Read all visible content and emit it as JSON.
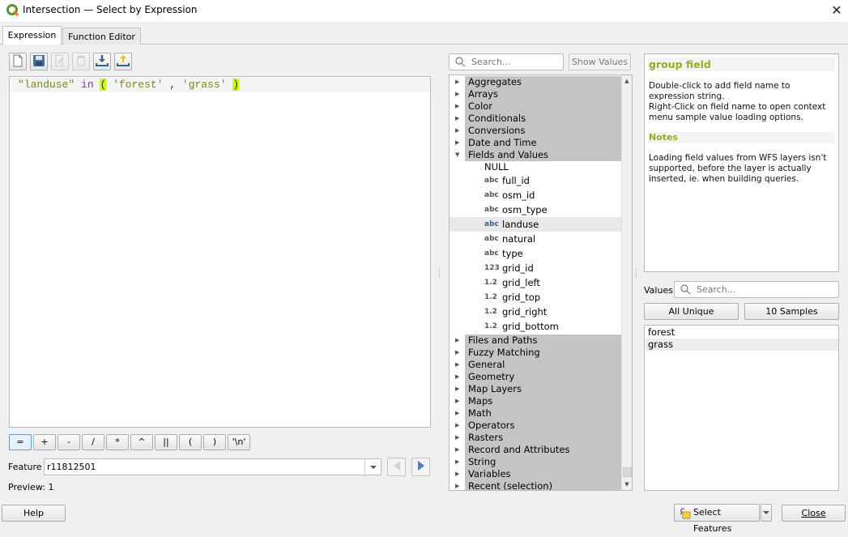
{
  "window": {
    "title": "Intersection — Select by Expression",
    "close_glyph": "✕"
  },
  "tabs": [
    {
      "label": "Expression",
      "active": true
    },
    {
      "label": "Function Editor",
      "active": false
    }
  ],
  "toolbar": {
    "buttons": [
      {
        "name": "new-file",
        "enabled": true
      },
      {
        "name": "save",
        "enabled": true
      },
      {
        "name": "edit",
        "enabled": false
      },
      {
        "name": "delete",
        "enabled": false
      },
      {
        "name": "import",
        "enabled": true
      },
      {
        "name": "export",
        "enabled": true
      }
    ]
  },
  "editor": {
    "tokens": [
      {
        "text": "\"landuse\"",
        "kind": "str"
      },
      {
        "text": " ",
        "kind": "plain"
      },
      {
        "text": "in",
        "kind": "kw"
      },
      {
        "text": " ",
        "kind": "plain"
      },
      {
        "text": "(",
        "kind": "paren"
      },
      {
        "text": " ",
        "kind": "plain"
      },
      {
        "text": "'forest'",
        "kind": "str"
      },
      {
        "text": " , ",
        "kind": "plain"
      },
      {
        "text": "'grass'",
        "kind": "str"
      },
      {
        "text": " ",
        "kind": "plain"
      },
      {
        "text": ")",
        "kind": "paren"
      }
    ]
  },
  "operators": [
    "=",
    "+",
    "-",
    "/",
    "*",
    "^",
    "||",
    "(",
    ")",
    "'\\n'"
  ],
  "feature": {
    "label": "Feature",
    "value": "r11812501"
  },
  "preview": {
    "label": "Preview:",
    "value": "1"
  },
  "function_panel": {
    "search_placeholder": "Search...",
    "show_values_label": "Show Values",
    "groups_before": [
      "Aggregates",
      "Arrays",
      "Color",
      "Conditionals",
      "Conversions",
      "Date and Time"
    ],
    "expanded_group": "Fields and Values",
    "null_item": "NULL",
    "fields": [
      {
        "type": "abc",
        "name": "full_id"
      },
      {
        "type": "abc",
        "name": "osm_id"
      },
      {
        "type": "abc",
        "name": "osm_type"
      },
      {
        "type": "abc",
        "name": "landuse",
        "highlighted": true
      },
      {
        "type": "abc",
        "name": "natural"
      },
      {
        "type": "abc",
        "name": "type"
      },
      {
        "type": "123",
        "name": "grid_id"
      },
      {
        "type": "1.2",
        "name": "grid_left"
      },
      {
        "type": "1.2",
        "name": "grid_top"
      },
      {
        "type": "1.2",
        "name": "grid_right"
      },
      {
        "type": "1.2",
        "name": "grid_bottom"
      }
    ],
    "groups_after": [
      "Files and Paths",
      "Fuzzy Matching",
      "General",
      "Geometry",
      "Map Layers",
      "Maps",
      "Math",
      "Operators",
      "Rasters",
      "Record and Attributes",
      "String",
      "Variables",
      "Recent (selection)"
    ]
  },
  "help_panel": {
    "title": "group field",
    "text_1": "Double-click to add field name to expression string.",
    "text_2": "Right-Click on field name to open context menu sample value loading options.",
    "notes_title": "Notes",
    "notes_text": "Loading field values from WFS layers isn't supported, before the layer is actually inserted, ie. when building queries.",
    "accent_color": "#93b023"
  },
  "values_panel": {
    "label": "Values",
    "search_placeholder": "Search...",
    "all_unique_label": "All Unique",
    "samples_label": "10 Samples",
    "items": [
      "forest",
      "grass"
    ]
  },
  "footer": {
    "help_label": "Help",
    "select_features_label": "Select Features",
    "close_label": "Close"
  }
}
